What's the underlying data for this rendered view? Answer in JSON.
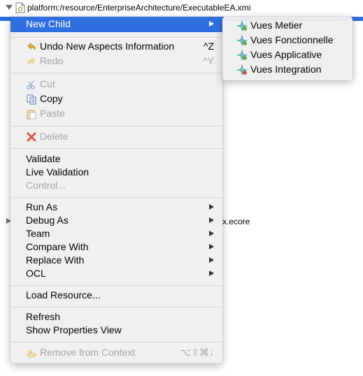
{
  "tree": {
    "root_path": "platform:/resource/EnterpriseArchitecture/ExecutableEA.xmi",
    "second_item_suffix": "x.ecore"
  },
  "context_menu": {
    "new_child": "New Child",
    "undo": "Undo New Aspects Information",
    "undo_shortcut": "^Z",
    "redo": "Redo",
    "redo_shortcut": "^Y",
    "cut": "Cut",
    "copy": "Copy",
    "paste": "Paste",
    "delete": "Delete",
    "validate": "Validate",
    "live_validation": "Live Validation",
    "control": "Control...",
    "run_as": "Run As",
    "debug_as": "Debug As",
    "team": "Team",
    "compare_with": "Compare With",
    "replace_with": "Replace With",
    "ocl": "OCL",
    "load_resource": "Load Resource...",
    "refresh": "Refresh",
    "show_properties_view": "Show Properties View",
    "remove_from_context": "Remove from Context",
    "remove_shortcut": "⌥⇧⌘↓"
  },
  "submenu": {
    "items": [
      {
        "label": "Vues Metier",
        "icon": "new-child-icon"
      },
      {
        "label": "Vues Fonctionnelle",
        "icon": "new-child-icon"
      },
      {
        "label": "Vues Applicative",
        "icon": "new-child-icon"
      },
      {
        "label": "Vues Integration",
        "icon": "new-child-icon-red"
      }
    ]
  },
  "colors": {
    "highlight": "#2f6fe0",
    "disabled_text": "#a6a6a6",
    "delete_icon": "#e0554a"
  }
}
